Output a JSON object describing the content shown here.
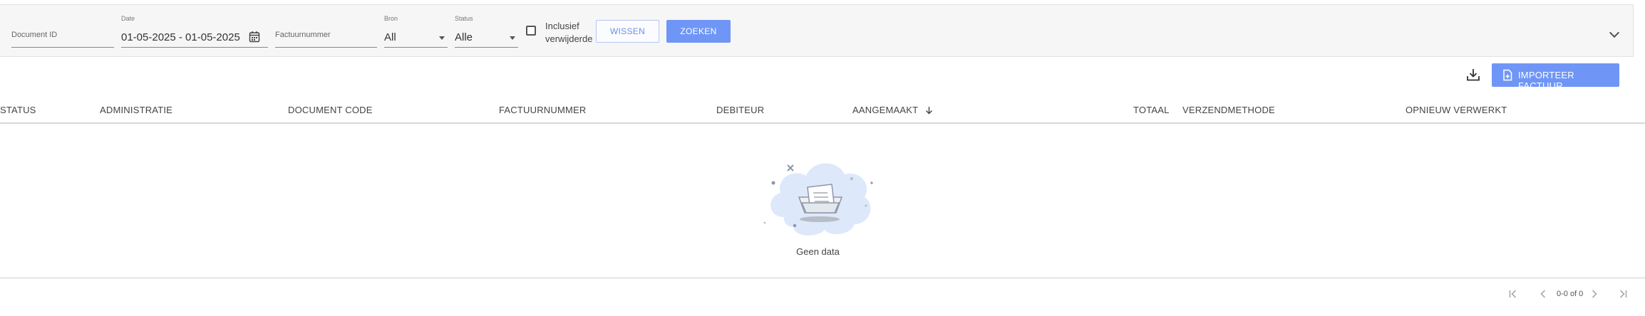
{
  "filters": {
    "document_id": {
      "placeholder": "Document ID"
    },
    "date": {
      "label": "Date",
      "value": "01-05-2025 - 01-05-2025"
    },
    "factuurnummer": {
      "placeholder": "Factuurnummer"
    },
    "bron": {
      "label": "Bron",
      "value": "All"
    },
    "status": {
      "label": "Status",
      "value": "Alle"
    },
    "inclusief": {
      "line1": "Inclusief",
      "line2": "verwijderde",
      "checked": false
    },
    "wissen_label": "WISSEN",
    "zoeken_label": "ZOEKEN"
  },
  "toolbar": {
    "import_label": "IMPORTEER FACTUUR",
    "download_icon": "download-icon"
  },
  "table": {
    "columns": [
      "STATUS",
      "ADMINISTRATIE",
      "DOCUMENT CODE",
      "FACTUURNUMMER",
      "DEBITEUR",
      "AANGEMAAKT",
      "TOTAAL",
      "VERZENDMETHODE",
      "OPNIEUW VERWERKT"
    ],
    "sort_column": "AANGEMAAKT",
    "sort_direction": "descending",
    "rows": [],
    "empty_text": "Geen data"
  },
  "pagination": {
    "range": "0-0 of 0"
  },
  "colors": {
    "primary": "#6f96f6",
    "outline_text": "#6f8fe8",
    "filterbar_bg": "#f6f6f6"
  }
}
